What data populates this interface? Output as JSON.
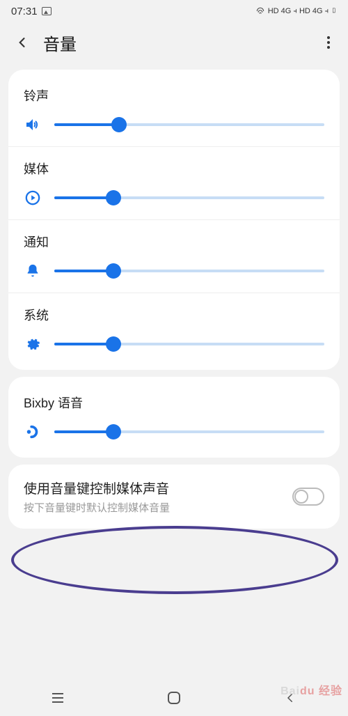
{
  "status": {
    "time": "07:31",
    "indicators": "HD 4G ⫞ HD 4G ⫞ ▯"
  },
  "header": {
    "title": "音量"
  },
  "sliders": [
    {
      "label": "铃声",
      "icon": "volume",
      "value": 24
    },
    {
      "label": "媒体",
      "icon": "play",
      "value": 22
    },
    {
      "label": "通知",
      "icon": "bell",
      "value": 22
    },
    {
      "label": "系统",
      "icon": "gear",
      "value": 22
    }
  ],
  "bixby": {
    "label": "Bixby 语音",
    "icon": "bixby",
    "value": 22
  },
  "toggle": {
    "title": "使用音量键控制媒体声音",
    "subtitle": "按下音量键时默认控制媒体音量",
    "on": false
  },
  "watermark": {
    "brand": "Bai",
    "sub": "du 经验"
  }
}
